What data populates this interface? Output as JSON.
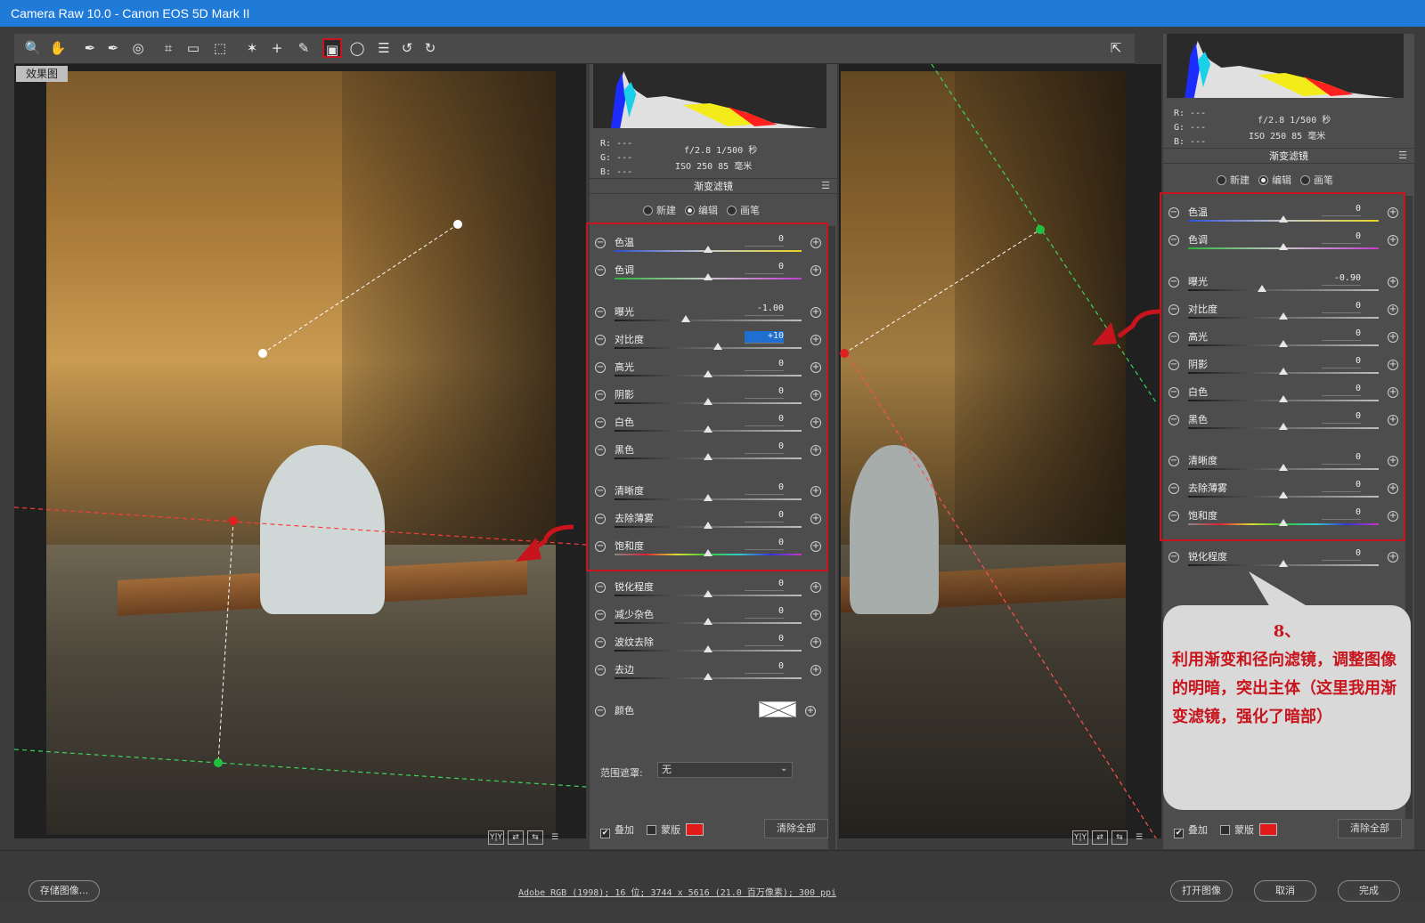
{
  "window": {
    "title": "Camera Raw 10.0 -  Canon EOS 5D Mark II"
  },
  "toolbar": {
    "tools": [
      {
        "name": "zoom-tool",
        "icon": "🔍"
      },
      {
        "name": "hand-tool",
        "icon": "✋"
      },
      {
        "name": "white-balance-tool",
        "icon": "✒"
      },
      {
        "name": "color-sampler-tool",
        "icon": "✒"
      },
      {
        "name": "targeted-adjustment-tool",
        "icon": "◎"
      },
      {
        "name": "crop-tool",
        "icon": "⌗"
      },
      {
        "name": "straighten-tool",
        "icon": "▭"
      },
      {
        "name": "transform-tool",
        "icon": "⬚"
      },
      {
        "name": "spot-removal-tool",
        "icon": "✶"
      },
      {
        "name": "red-eye-tool",
        "icon": "+"
      },
      {
        "name": "adjustment-brush-tool",
        "icon": "✎"
      },
      {
        "name": "graduated-filter-tool",
        "icon": "▣"
      },
      {
        "name": "radial-filter-tool",
        "icon": "◯"
      },
      {
        "name": "preferences-tool",
        "icon": "☰"
      },
      {
        "name": "rotate-left-tool",
        "icon": "↺"
      },
      {
        "name": "rotate-right-tool",
        "icon": "↻"
      }
    ],
    "fullscreen_icon": "⇱"
  },
  "left_view": {
    "tag": "效果图"
  },
  "panels": [
    {
      "id": "left",
      "rgb": {
        "r": "R: ---",
        "g": "G: ---",
        "b": "B: ---"
      },
      "exif": {
        "line1": "f/2.8  1/500 秒",
        "line2": "ISO 250  85 毫米"
      },
      "title": "渐变滤镜",
      "modes": [
        "新建",
        "编辑",
        "画笔"
      ],
      "selected_mode": "编辑",
      "sliders": [
        {
          "label": "色温",
          "value": "0",
          "pos": 0.5,
          "track": "temp"
        },
        {
          "label": "色调",
          "value": "0",
          "pos": 0.5,
          "track": "tint"
        },
        {
          "label": "曝光",
          "value": "-1.00",
          "pos": 0.38,
          "track": "gray"
        },
        {
          "label": "对比度",
          "value": "+10",
          "pos": 0.55,
          "track": "gray",
          "selected": true
        },
        {
          "label": "高光",
          "value": "0",
          "pos": 0.5,
          "track": "gray"
        },
        {
          "label": "阴影",
          "value": "0",
          "pos": 0.5,
          "track": "gray"
        },
        {
          "label": "白色",
          "value": "0",
          "pos": 0.5,
          "track": "gray"
        },
        {
          "label": "黑色",
          "value": "0",
          "pos": 0.5,
          "track": "gray"
        },
        {
          "label": "清晰度",
          "value": "0",
          "pos": 0.5,
          "track": "gray"
        },
        {
          "label": "去除薄雾",
          "value": "0",
          "pos": 0.5,
          "track": "gray"
        },
        {
          "label": "饱和度",
          "value": "0",
          "pos": 0.5,
          "track": "sat"
        },
        {
          "label": "锐化程度",
          "value": "0",
          "pos": 0.5,
          "track": "gray"
        },
        {
          "label": "减少杂色",
          "value": "0",
          "pos": 0.5,
          "track": "gray"
        },
        {
          "label": "波纹去除",
          "value": "0",
          "pos": 0.5,
          "track": "gray"
        },
        {
          "label": "去边",
          "value": "0",
          "pos": 0.5,
          "track": "gray"
        }
      ],
      "color_label": "颜色",
      "range_mask_label": "范围遮罩:",
      "range_mask_value": "无",
      "overlay_label": "叠加",
      "mask_label": "蒙版",
      "clear_all": "清除全部"
    },
    {
      "id": "right",
      "rgb": {
        "r": "R: ---",
        "g": "G: ---",
        "b": "B: ---"
      },
      "exif": {
        "line1": "f/2.8  1/500 秒",
        "line2": "ISO 250  85 毫米"
      },
      "title": "渐变滤镜",
      "modes": [
        "新建",
        "编辑",
        "画笔"
      ],
      "selected_mode": "编辑",
      "sliders": [
        {
          "label": "色温",
          "value": "0",
          "pos": 0.5,
          "track": "temp"
        },
        {
          "label": "色调",
          "value": "0",
          "pos": 0.5,
          "track": "tint"
        },
        {
          "label": "曝光",
          "value": "-0.90",
          "pos": 0.39,
          "track": "gray"
        },
        {
          "label": "对比度",
          "value": "0",
          "pos": 0.5,
          "track": "gray"
        },
        {
          "label": "高光",
          "value": "0",
          "pos": 0.5,
          "track": "gray"
        },
        {
          "label": "阴影",
          "value": "0",
          "pos": 0.5,
          "track": "gray"
        },
        {
          "label": "白色",
          "value": "0",
          "pos": 0.5,
          "track": "gray"
        },
        {
          "label": "黑色",
          "value": "0",
          "pos": 0.5,
          "track": "gray"
        },
        {
          "label": "清晰度",
          "value": "0",
          "pos": 0.5,
          "track": "gray"
        },
        {
          "label": "去除薄雾",
          "value": "0",
          "pos": 0.5,
          "track": "gray"
        },
        {
          "label": "饱和度",
          "value": "0",
          "pos": 0.5,
          "track": "sat"
        },
        {
          "label": "锐化程度",
          "value": "0",
          "pos": 0.5,
          "track": "gray"
        }
      ],
      "overlay_label": "叠加",
      "mask_label": "蒙版",
      "clear_all": "清除全部"
    }
  ],
  "callout": {
    "number": "8、",
    "text": "利用渐变和径向滤镜，调整图像的明暗，突出主体（这里我用渐变滤镜，强化了暗部）"
  },
  "bottom": {
    "save_label": "存储图像...",
    "workflow_info": "Adobe RGB (1998); 16 位; 3744 x 5616 (21.0 百万像素); 300 ppi",
    "open_label": "打开图像",
    "cancel_label": "取消",
    "done_label": "完成"
  },
  "colors": {
    "accent_red": "#c8141c",
    "title_blue": "#1f7ad8",
    "selected_blue": "#1e6fd0"
  }
}
